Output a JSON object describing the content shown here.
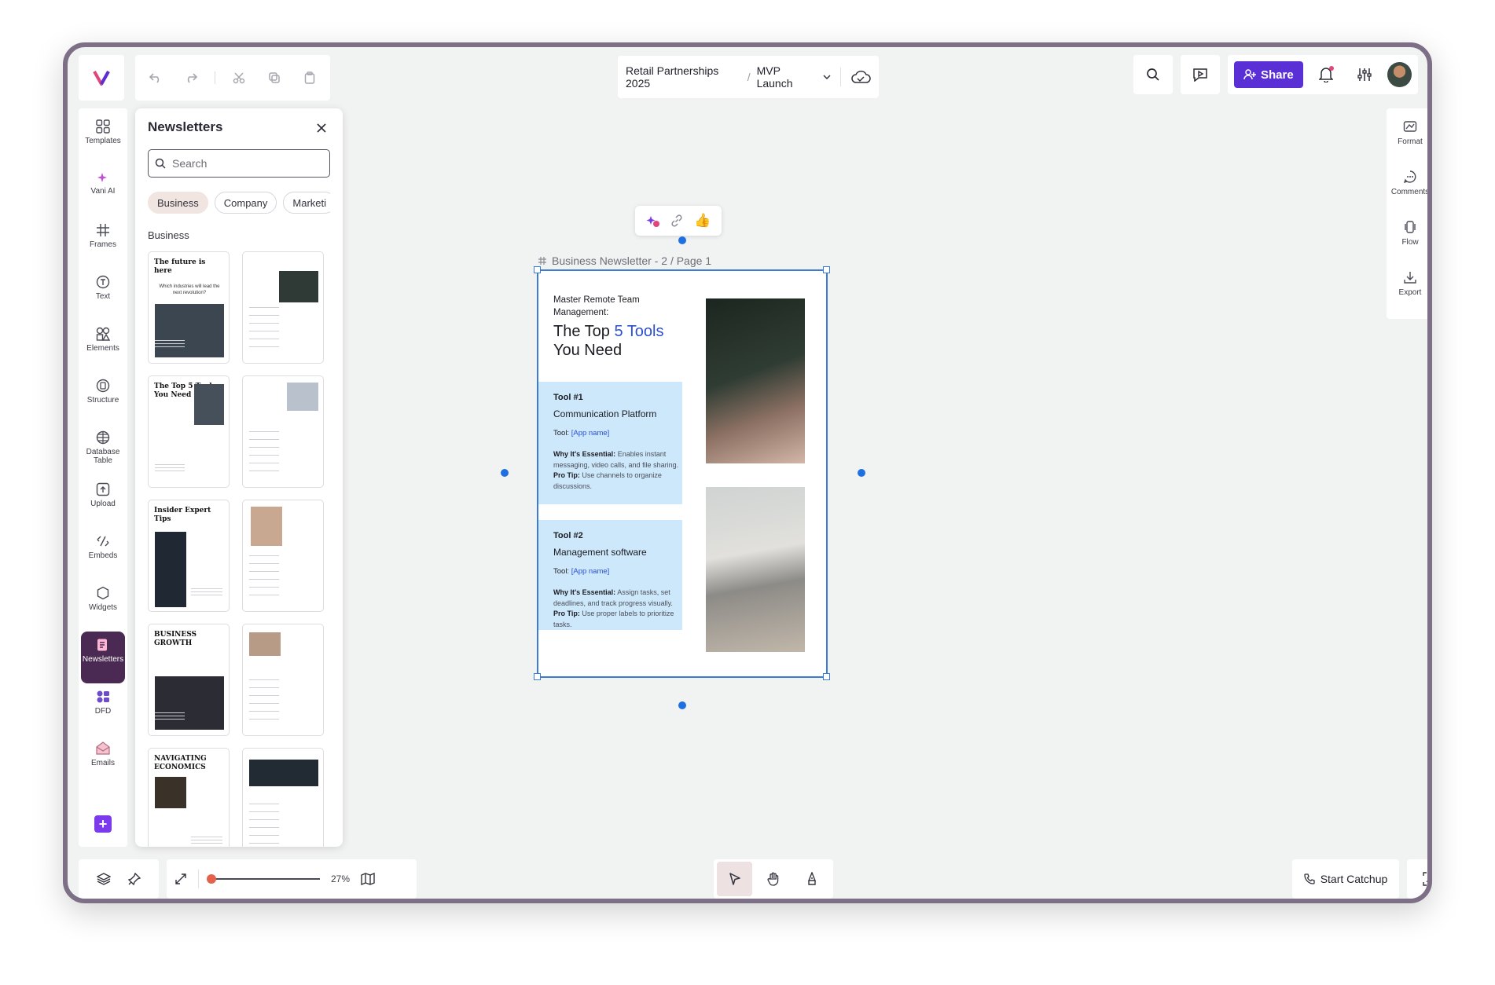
{
  "top": {
    "logo_icon": "vani-logo-icon",
    "breadcrumb": {
      "project": "Retail Partnerships 2025",
      "separator": "/",
      "board": "MVP Launch"
    },
    "share_label": "Share"
  },
  "rail": [
    {
      "label": "Templates",
      "icon": "templates-icon"
    },
    {
      "label": "Vani AI",
      "icon": "sparkle-icon"
    },
    {
      "label": "Frames",
      "icon": "hash-icon"
    },
    {
      "label": "Text",
      "icon": "text-icon"
    },
    {
      "label": "Elements",
      "icon": "elements-icon"
    },
    {
      "label": "Structure",
      "icon": "structure-icon"
    },
    {
      "label": "Database Table",
      "icon": "database-icon"
    },
    {
      "label": "Upload",
      "icon": "upload-icon"
    },
    {
      "label": "Embeds",
      "icon": "embed-icon"
    },
    {
      "label": "Widgets",
      "icon": "widget-icon"
    },
    {
      "label": "Newsletters",
      "icon": "newsletter-icon",
      "active": true
    },
    {
      "label": "DFD",
      "icon": "dfd-icon"
    },
    {
      "label": "Emails",
      "icon": "email-icon"
    }
  ],
  "panel": {
    "title": "Newsletters",
    "search_placeholder": "Search",
    "chips": [
      "Business",
      "Company",
      "Marketi"
    ],
    "section": "Business",
    "thumbs": [
      {
        "title": "The future is here",
        "subtitle": "Which industries will lead the next revolution?"
      },
      {
        "title": ""
      },
      {
        "title": "The Top 5 Tools You Need"
      },
      {
        "title": ""
      },
      {
        "title": "Insider Expert Tips"
      },
      {
        "title": ""
      },
      {
        "title": "BUSINESS GROWTH"
      },
      {
        "title": ""
      },
      {
        "title": "NAVIGATING ECONOMICS"
      },
      {
        "title": ""
      }
    ]
  },
  "canvas": {
    "frame_title": "Business Newsletter - 2 / Page 1",
    "reactions": [
      "sticker-icon",
      "link-icon",
      "thumbs-up-icon"
    ],
    "page": {
      "kicker": "Master Remote Team Management:",
      "headline_pre": "The Top",
      "headline_hl": "5 Tools",
      "headline_post": "You Need",
      "tool1": {
        "num": "Tool #1",
        "name": "Communication Platform",
        "tool_label": "Tool:",
        "tool_value": "[App name]",
        "why_label": "Why It's Essential:",
        "why": "Enables instant messaging, video calls, and file sharing.",
        "tip_label": "Pro Tip:",
        "tip": "Use channels to organize discussions."
      },
      "tool2": {
        "num": "Tool #2",
        "name": "Management software",
        "tool_label": "Tool:",
        "tool_value": "[App name]",
        "why_label": "Why It's Essential:",
        "why": "Assign tasks, set deadlines, and track progress visually.",
        "tip_label": "Pro Tip:",
        "tip": "Use proper labels to prioritize tasks."
      }
    }
  },
  "right_rail": [
    {
      "label": "Format",
      "icon": "format-icon"
    },
    {
      "label": "Comments",
      "icon": "comment-icon"
    },
    {
      "label": "Flow",
      "icon": "flow-icon"
    },
    {
      "label": "Export",
      "icon": "export-icon"
    }
  ],
  "bottom": {
    "zoom": "27%",
    "catchup_label": "Start Catchup"
  },
  "colors": {
    "accent": "#5a2fd6",
    "selection": "#3a7bd5",
    "highlight": "#2a4fd1",
    "card_blue": "#cde8fb"
  }
}
